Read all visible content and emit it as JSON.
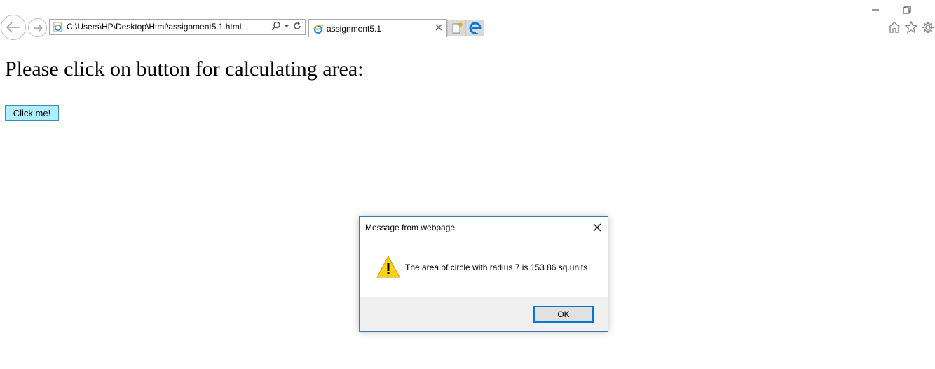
{
  "browser": {
    "address_url": "C:\\Users\\HP\\Desktop\\Html\\assignment5.1.html",
    "tab_title": "assignment5.1"
  },
  "page": {
    "heading": "Please click on button for calculating area:",
    "button_label": "Click me!"
  },
  "dialog": {
    "title": "Message from webpage",
    "message": "The area of circle with radius 7 is 153.86 sq.units",
    "ok_label": "OK"
  },
  "colors": {
    "click_button_bg": "#aeeefe",
    "dialog_border": "#3b79b6",
    "ok_button_border": "#0078d7",
    "warning_yellow": "#fcd116"
  },
  "icons": [
    "back-arrow-icon",
    "forward-arrow-icon",
    "ie-page-icon",
    "search-icon",
    "dropdown-arrow-icon",
    "refresh-icon",
    "tab-close-icon",
    "new-tab-icon",
    "edge-icon",
    "minimize-icon",
    "restore-icon",
    "home-icon",
    "favorites-star-icon",
    "settings-gear-icon",
    "dialog-close-icon",
    "warning-icon"
  ]
}
